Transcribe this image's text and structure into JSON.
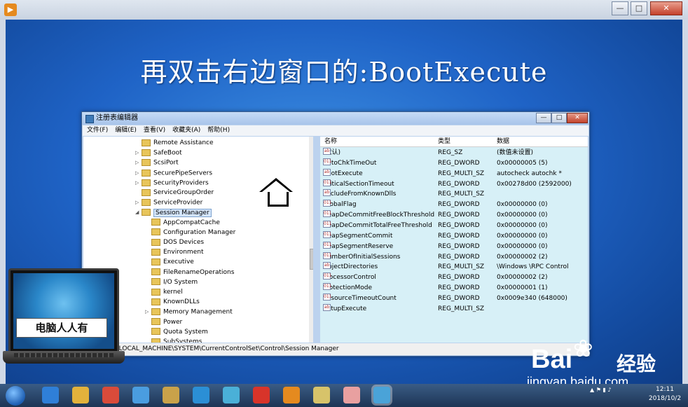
{
  "player": {
    "logo_icon": "player-logo-icon",
    "min": "—",
    "max": "□",
    "close": "✕"
  },
  "slide": {
    "headline": "再双击右边窗口的:BootExecute"
  },
  "window": {
    "title": "注册表编辑器",
    "buttons": {
      "min": "—",
      "max": "□",
      "close": "✕"
    },
    "menu": [
      "文件(F)",
      "编辑(E)",
      "查看(V)",
      "收藏夹(A)",
      "帮助(H)"
    ]
  },
  "tree": [
    {
      "label": "Remote Assistance",
      "level": 1,
      "expand": ""
    },
    {
      "label": "SafeBoot",
      "level": 1,
      "expand": "▷"
    },
    {
      "label": "ScsiPort",
      "level": 1,
      "expand": "▷"
    },
    {
      "label": "SecurePipeServers",
      "level": 1,
      "expand": "▷"
    },
    {
      "label": "SecurityProviders",
      "level": 1,
      "expand": "▷"
    },
    {
      "label": "ServiceGroupOrder",
      "level": 1,
      "expand": ""
    },
    {
      "label": "ServiceProvider",
      "level": 1,
      "expand": "▷"
    },
    {
      "label": "Session Manager",
      "level": 1,
      "expand": "◢",
      "selected": true
    },
    {
      "label": "AppCompatCache",
      "level": 2,
      "expand": ""
    },
    {
      "label": "Configuration Manager",
      "level": 2,
      "expand": ""
    },
    {
      "label": "DOS Devices",
      "level": 2,
      "expand": ""
    },
    {
      "label": "Environment",
      "level": 2,
      "expand": ""
    },
    {
      "label": "Executive",
      "level": 2,
      "expand": ""
    },
    {
      "label": "FileRenameOperations",
      "level": 2,
      "expand": ""
    },
    {
      "label": "I/O System",
      "level": 2,
      "expand": ""
    },
    {
      "label": "kernel",
      "level": 2,
      "expand": ""
    },
    {
      "label": "KnownDLLs",
      "level": 2,
      "expand": ""
    },
    {
      "label": "Memory Management",
      "level": 2,
      "expand": "▷"
    },
    {
      "label": "Power",
      "level": 2,
      "expand": ""
    },
    {
      "label": "Quota System",
      "level": 2,
      "expand": ""
    },
    {
      "label": "SubSystems",
      "level": 2,
      "expand": ""
    }
  ],
  "list": {
    "headers": {
      "name": "名称",
      "type": "类型",
      "data": "数据"
    },
    "rows": [
      {
        "icon": "ab",
        "name": "(默认)",
        "type": "REG_SZ",
        "data": "(数值未设置)"
      },
      {
        "icon": "011",
        "name": "AutoChkTimeOut",
        "type": "REG_DWORD",
        "data": "0x00000005 (5)"
      },
      {
        "icon": "ab",
        "name": "BootExecute",
        "type": "REG_MULTI_SZ",
        "data": "autocheck autochk *"
      },
      {
        "icon": "011",
        "name": "CriticalSectionTimeout",
        "type": "REG_DWORD",
        "data": "0x00278d00 (2592000)"
      },
      {
        "icon": "ab",
        "name": "ExcludeFromKnownDlls",
        "type": "REG_MULTI_SZ",
        "data": ""
      },
      {
        "icon": "011",
        "name": "GlobalFlag",
        "type": "REG_DWORD",
        "data": "0x00000000 (0)"
      },
      {
        "icon": "011",
        "name": "HeapDeCommitFreeBlockThreshold",
        "type": "REG_DWORD",
        "data": "0x00000000 (0)"
      },
      {
        "icon": "011",
        "name": "HeapDeCommitTotalFreeThreshold",
        "type": "REG_DWORD",
        "data": "0x00000000 (0)"
      },
      {
        "icon": "011",
        "name": "HeapSegmentCommit",
        "type": "REG_DWORD",
        "data": "0x00000000 (0)"
      },
      {
        "icon": "011",
        "name": "HeapSegmentReserve",
        "type": "REG_DWORD",
        "data": "0x00000000 (0)"
      },
      {
        "icon": "011",
        "name": "NumberOfInitialSessions",
        "type": "REG_DWORD",
        "data": "0x00000002 (2)"
      },
      {
        "icon": "ab",
        "name": "ObjectDirectories",
        "type": "REG_MULTI_SZ",
        "data": "\\Windows \\RPC Control"
      },
      {
        "icon": "011",
        "name": "ProcessorControl",
        "type": "REG_DWORD",
        "data": "0x00000002 (2)"
      },
      {
        "icon": "011",
        "name": "ProtectionMode",
        "type": "REG_DWORD",
        "data": "0x00000001 (1)"
      },
      {
        "icon": "011",
        "name": "ResourceTimeoutCount",
        "type": "REG_DWORD",
        "data": "0x0009e340 (648000)"
      },
      {
        "icon": "ab",
        "name": "SetupExecute",
        "type": "REG_MULTI_SZ",
        "data": ""
      }
    ]
  },
  "status": {
    "path": "EY_LOCAL_MACHINE\\SYSTEM\\CurrentControlSet\\Control\\Session Manager"
  },
  "logo": {
    "brand": "电脑人人有"
  },
  "watermark": {
    "brand": "Bai",
    "paw": "❀",
    "brand2": "经验",
    "url": "jingyan.baidu.com"
  },
  "taskbar": {
    "clock_time": "12:11",
    "clock_date": "2018/10/2",
    "icons": [
      "ie-icon",
      "folder-icon",
      "chrome-icon",
      "qq-icon",
      "paint-icon",
      "browser-icon",
      "pinwheel-icon",
      "game-icon",
      "player-icon",
      "notes-icon",
      "monkey-icon",
      "regedit-icon"
    ],
    "colors": [
      "#2f7fd8",
      "#e2b23c",
      "#d94b3a",
      "#4a9de0",
      "#c9a24a",
      "#2b8fd6",
      "#4ab0d8",
      "#d8342a",
      "#e58a1f",
      "#d7c36a",
      "#e8a0a0",
      "#4aa3d8"
    ]
  }
}
